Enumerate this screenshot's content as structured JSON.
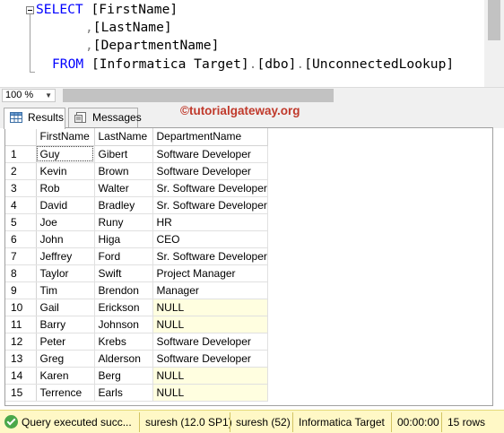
{
  "editor": {
    "line1": {
      "keyword": "SELECT",
      "text": " [FirstName]"
    },
    "line2": {
      "comma": ",",
      "text": "[LastName]"
    },
    "line3": {
      "comma": ",",
      "text": "[DepartmentName]"
    },
    "line4": {
      "keyword": "FROM",
      "text": " [Informatica Target]",
      "dot1": ".",
      "schema": "[dbo]",
      "dot2": ".",
      "table": "[UnconnectedLookup]"
    }
  },
  "zoom": {
    "value": "100 %"
  },
  "tabs": {
    "results": "Results",
    "messages": "Messages"
  },
  "watermark": "©tutorialgateway.org",
  "grid": {
    "columns": [
      "FirstName",
      "LastName",
      "DepartmentName"
    ],
    "rows": [
      {
        "n": "1",
        "first": "Guy",
        "last": "Gibert",
        "dept": "Software Developer"
      },
      {
        "n": "2",
        "first": "Kevin",
        "last": "Brown",
        "dept": "Software Developer"
      },
      {
        "n": "3",
        "first": "Rob",
        "last": "Walter",
        "dept": "Sr. Software Developer"
      },
      {
        "n": "4",
        "first": "David",
        "last": "Bradley",
        "dept": "Sr. Software Developer"
      },
      {
        "n": "5",
        "first": "Joe",
        "last": "Runy",
        "dept": "HR"
      },
      {
        "n": "6",
        "first": "John",
        "last": "Higa",
        "dept": "CEO"
      },
      {
        "n": "7",
        "first": "Jeffrey",
        "last": "Ford",
        "dept": "Sr. Software Developer"
      },
      {
        "n": "8",
        "first": "Taylor",
        "last": "Swift",
        "dept": "Project Manager"
      },
      {
        "n": "9",
        "first": "Tim",
        "last": "Brendon",
        "dept": "Manager"
      },
      {
        "n": "10",
        "first": "Gail",
        "last": "Erickson",
        "dept": "NULL"
      },
      {
        "n": "11",
        "first": "Barry",
        "last": "Johnson",
        "dept": "NULL"
      },
      {
        "n": "12",
        "first": "Peter",
        "last": "Krebs",
        "dept": "Software Developer"
      },
      {
        "n": "13",
        "first": "Greg",
        "last": "Alderson",
        "dept": "Software Developer"
      },
      {
        "n": "14",
        "first": "Karen",
        "last": "Berg",
        "dept": "NULL"
      },
      {
        "n": "15",
        "first": "Terrence",
        "last": "Earls",
        "dept": "NULL"
      }
    ]
  },
  "status": {
    "message": "Query executed succ...",
    "server": "suresh (12.0 SP1)",
    "user": "suresh (52)",
    "database": "Informatica Target",
    "time": "00:00:00",
    "rows": "15 rows"
  },
  "colors": {
    "keyword": "#0000ff",
    "watermark": "#c0392b",
    "statusbar": "#fff8c6",
    "null_cell": "#fffee0"
  },
  "icons": {
    "results": "grid-icon",
    "messages": "messages-icon",
    "status": "check-circle-icon"
  }
}
